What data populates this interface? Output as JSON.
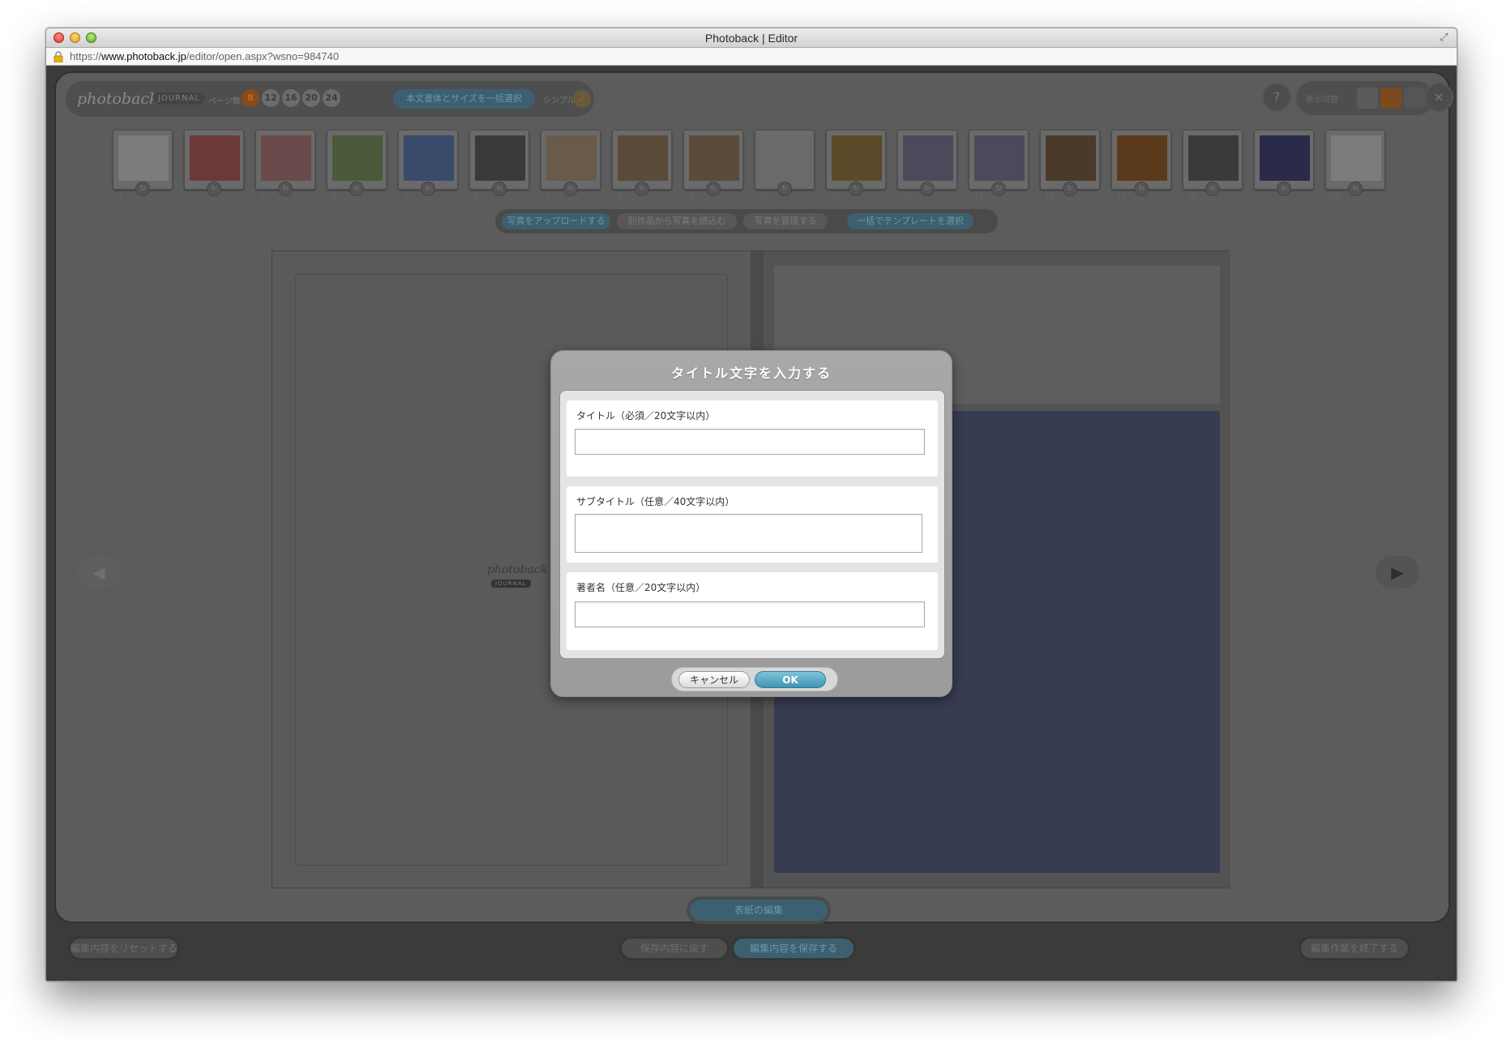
{
  "window": {
    "title": "Photoback | Editor",
    "url_prefix": "https://",
    "url_host": "www.photoback.jp",
    "url_path": "/editor/open.aspx?wsno=984740"
  },
  "toolbar": {
    "logo": "photoback",
    "journal": "JOURNAL",
    "pages_label": "ページ数",
    "page_options": [
      "8",
      "12",
      "16",
      "20",
      "24"
    ],
    "selected_page": "8",
    "font_button": "本文書体とサイズを一括選択",
    "simple_label": "シンプル",
    "help": "?",
    "view_label": "表示切替",
    "close": "×"
  },
  "thumbnails": {
    "numbers": [
      "1",
      "2",
      "3",
      "4",
      "5",
      "6",
      "7",
      "8",
      "9",
      "10",
      "11",
      "12",
      "13",
      "14",
      "15",
      "16",
      "17",
      "18"
    ],
    "colors": [
      "#7c7c7c",
      "#6a3a3a",
      "#6a4a4a",
      "#4a5a3a",
      "#3a4a6a",
      "#3a3a3a",
      "#6a5a4a",
      "#5a4a3a",
      "#5a4a3a",
      "#6a6a6a",
      "#5a4a2a",
      "#4a4a5a",
      "#4a4a5a",
      "#4a3a2a",
      "#5a3a1a",
      "#3a3a3a",
      "#2a2a4a",
      "#7c7c7c"
    ]
  },
  "photo_actions": {
    "upload": "写真をアップロードする",
    "import": "別作品から写真を読込む",
    "manage": "写真を管理する",
    "template": "一括でテンプレートを選択"
  },
  "book": {
    "mini_logo": "photoback",
    "mini_journal": "JOURNAL"
  },
  "cover_edit": "表紙の編集",
  "bottom": {
    "reset": "編集内容をリセットする",
    "revert": "保存内容に戻す",
    "save": "編集内容を保存する",
    "finish": "編集作業を終了する"
  },
  "dialog": {
    "title": "タイトル文字を入力する",
    "title_label": "タイトル（必須／20文字以内）",
    "title_value": "",
    "subtitle_label": "サブタイトル（任意／40文字以内）",
    "subtitle_value": "",
    "author_label": "著者名（任意／20文字以内）",
    "author_value": "",
    "cancel": "キャンセル",
    "ok": "OK"
  }
}
